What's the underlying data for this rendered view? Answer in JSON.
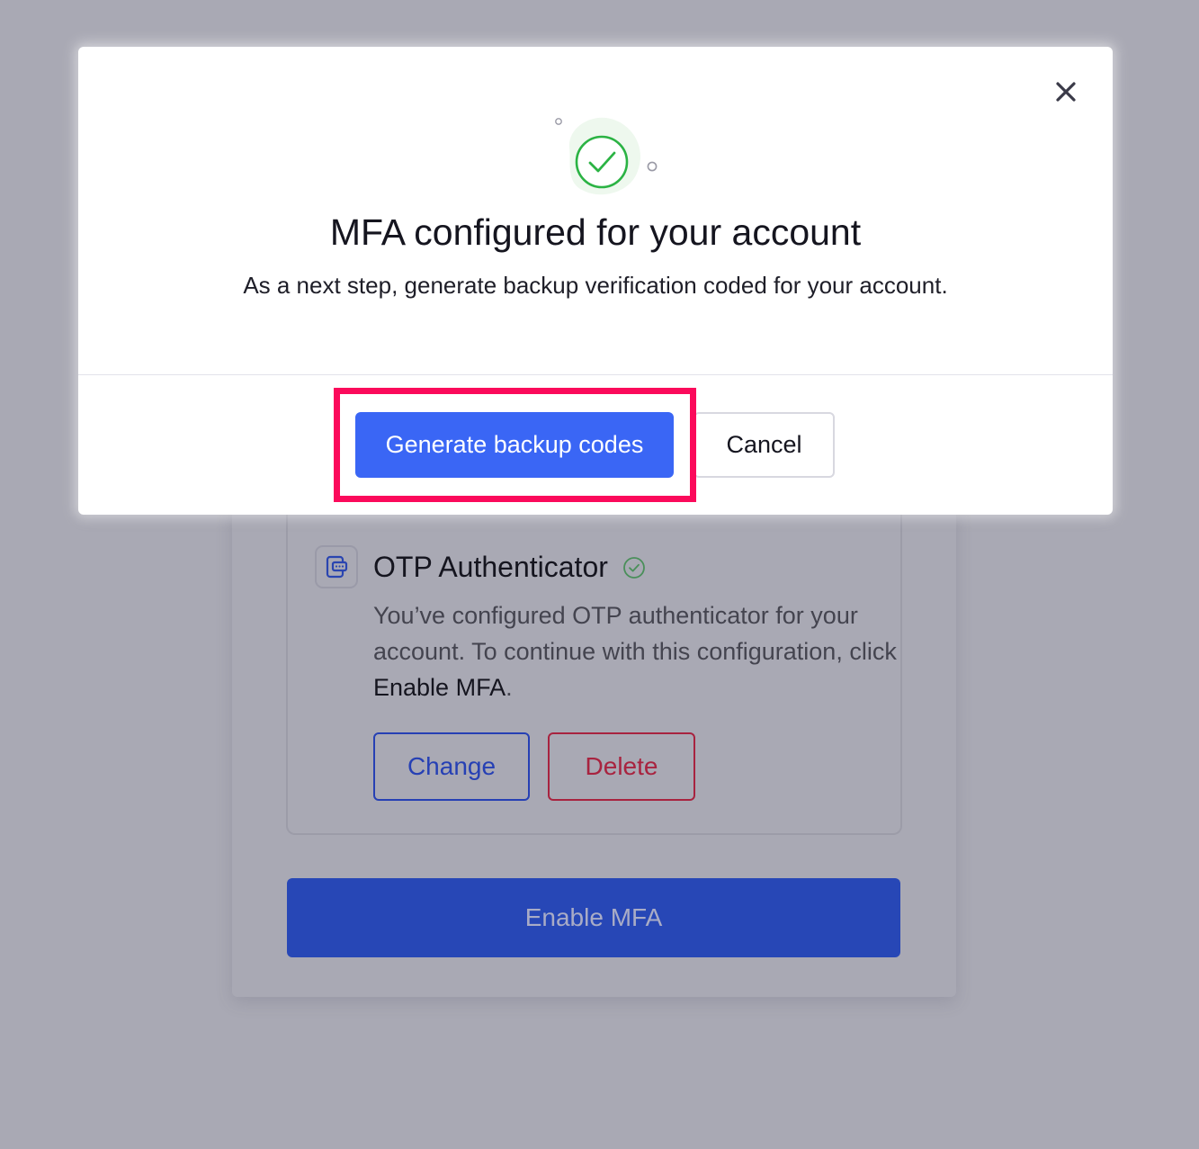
{
  "modal": {
    "title": "MFA configured for your account",
    "subtitle": "As a next step, generate backup verification coded for your account.",
    "primary_button": "Generate backup codes",
    "secondary_button": "Cancel",
    "close_icon": "close-icon",
    "illustration_icon": "check-circle-icon"
  },
  "background": {
    "method": {
      "icon": "otp-device-icon",
      "title": "OTP Authenticator",
      "status_icon": "check-circle-icon",
      "description_prefix": "You’ve configured OTP authenticator for your account. To continue with this configuration, click ",
      "description_action": "Enable MFA",
      "description_suffix": ".",
      "change_button": "Change",
      "delete_button": "Delete"
    },
    "enable_button": "Enable MFA"
  },
  "colors": {
    "overlay": "#a9a9b4",
    "primary": "#3a66f5",
    "success": "#2bb344",
    "danger": "#a8233f",
    "highlight": "#fb0a5b"
  }
}
